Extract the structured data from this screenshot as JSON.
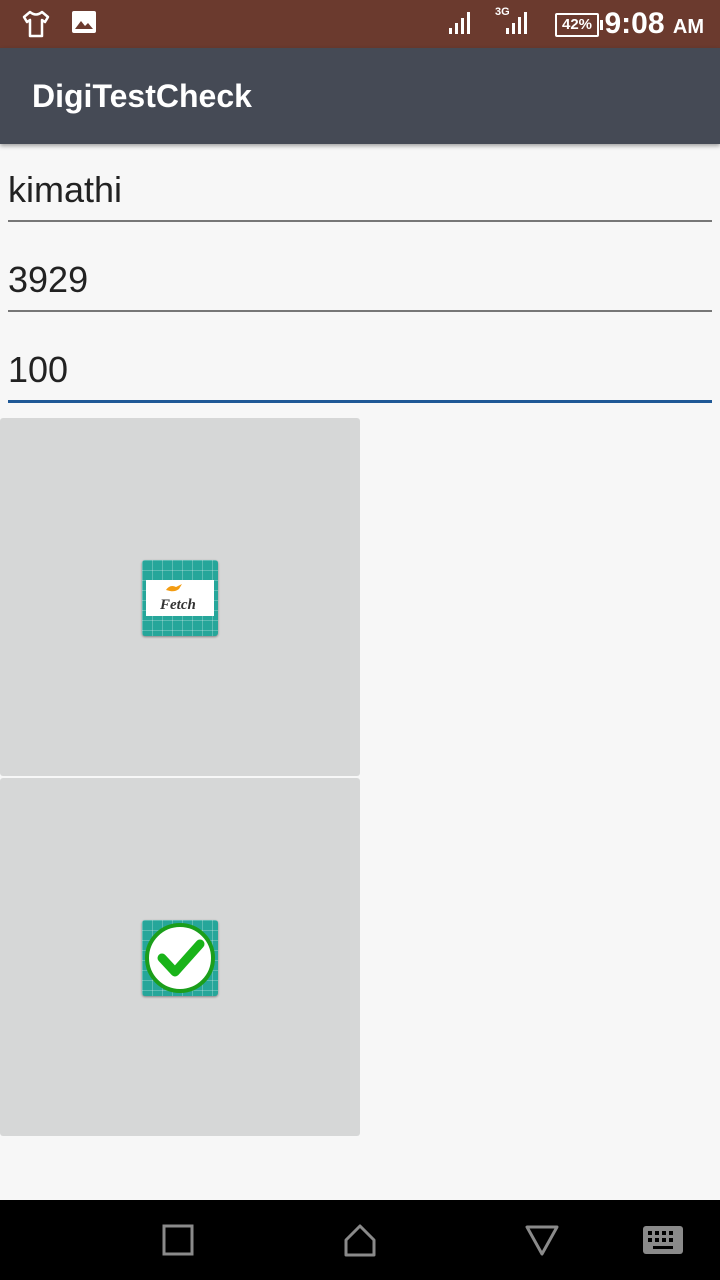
{
  "status_bar": {
    "time": "9:08",
    "ampm": "AM",
    "battery": "42%",
    "icons": [
      "tshirt-icon",
      "image-icon",
      "signal-icon",
      "signal-3g-icon",
      "battery-icon"
    ],
    "background": "#6b3a2e"
  },
  "app_bar": {
    "title": "DigiTestCheck",
    "background": "#454a55"
  },
  "form": {
    "field1_value": "kimathi",
    "field2_value": "3929",
    "field3_value": "100",
    "accent": "#1f5896"
  },
  "buttons": {
    "fetch_icon": "fetch-icon",
    "fetch_logo_text": "Fetch",
    "confirm_icon": "checkmark-icon"
  },
  "nav_bar": {
    "items": [
      "recents-icon",
      "home-icon",
      "back-icon",
      "keyboard-icon"
    ]
  }
}
